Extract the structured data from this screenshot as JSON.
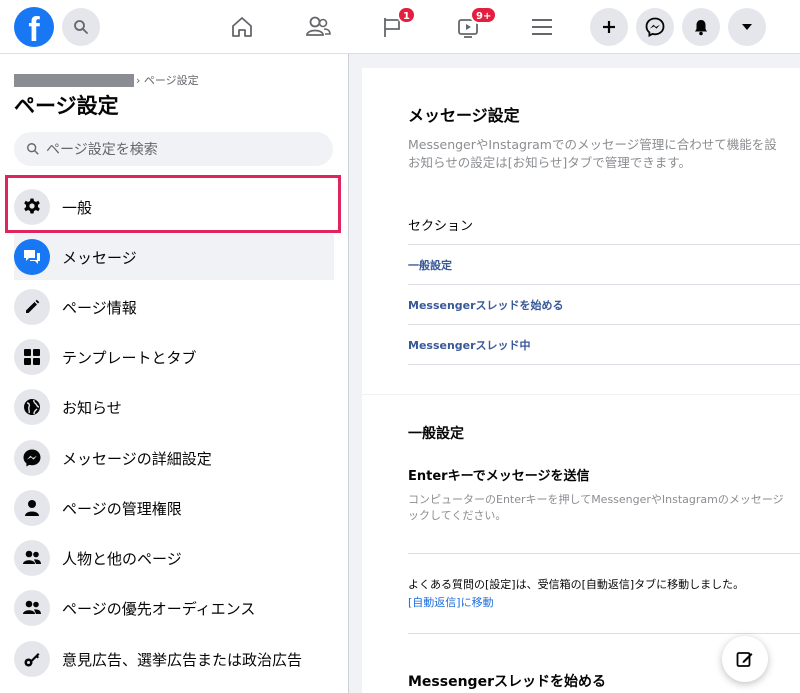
{
  "topbar": {
    "logo_letter": "f",
    "badges": {
      "pages": "1",
      "watch": "9+"
    },
    "colors": {
      "brand": "#1877f2",
      "badge": "#e41e3f"
    }
  },
  "sidebar": {
    "breadcrumb": "› ページ設定",
    "title": "ページ設定",
    "search_placeholder": "ページ設定を検索",
    "items": [
      {
        "label": "一般",
        "icon": "gear-icon"
      },
      {
        "label": "メッセージ",
        "icon": "message-bubbles-icon"
      },
      {
        "label": "ページ情報",
        "icon": "pencil-icon"
      },
      {
        "label": "テンプレートとタブ",
        "icon": "grid-icon"
      },
      {
        "label": "お知らせ",
        "icon": "globe-icon"
      },
      {
        "label": "メッセージの詳細設定",
        "icon": "messenger-icon"
      },
      {
        "label": "ページの管理権限",
        "icon": "person-icon"
      },
      {
        "label": "人物と他のページ",
        "icon": "people-icon"
      },
      {
        "label": "ページの優先オーディエンス",
        "icon": "people-icon"
      },
      {
        "label": "意見広告、選挙広告または政治広告",
        "icon": "key-icon"
      }
    ],
    "active_index": 1
  },
  "main": {
    "title": "メッセージ設定",
    "desc_line1": "MessengerやInstagramでのメッセージ管理に合わせて機能を設",
    "desc_line2": "お知らせの設定は[お知らせ]タブで管理できます。",
    "section_header": "セクション",
    "section_links": [
      "一般設定",
      "Messengerスレッドを始める",
      "Messengerスレッド中"
    ],
    "general": {
      "title": "一般設定",
      "enter_title": "Enterキーでメッセージを送信",
      "enter_desc1": "コンピューターのEnterキーを押してMessengerやInstagramのメッセージ",
      "enter_desc2": "ックしてください。",
      "note": "よくある質問の[設定]は、受信箱の[自動返信]タブに移動しました。",
      "note_link": "[自動返信]に移動"
    },
    "next_section_title": "Messengerスレッドを始める"
  }
}
